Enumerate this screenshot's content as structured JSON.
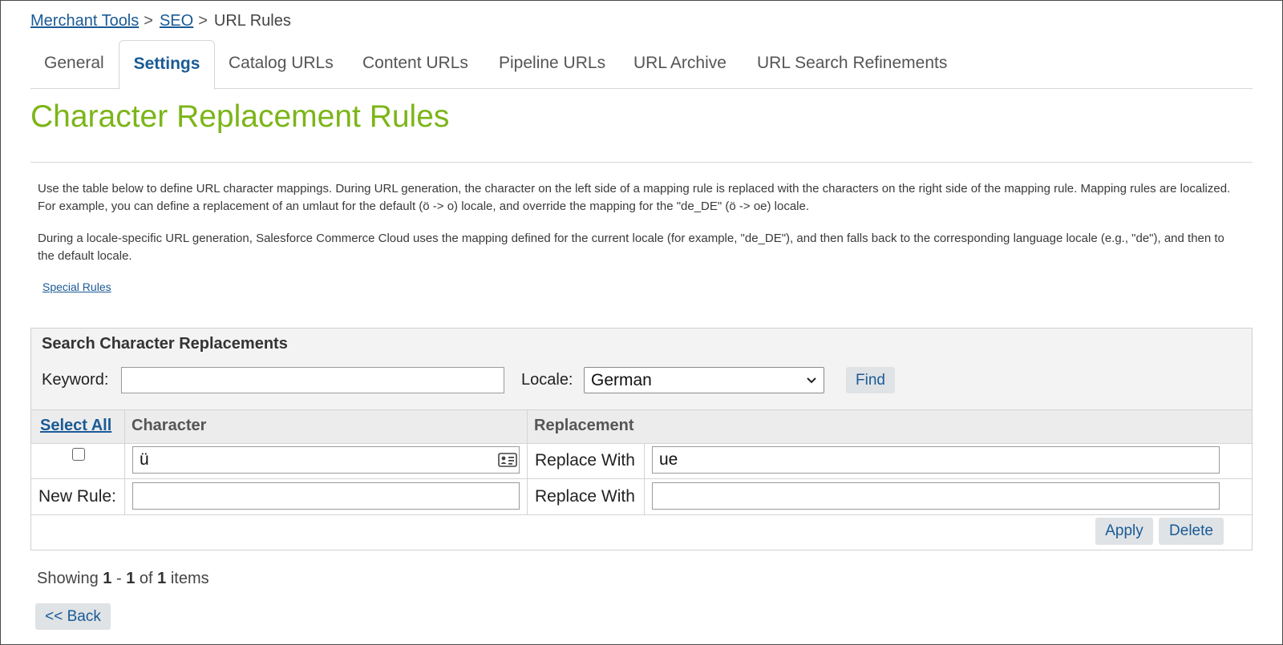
{
  "breadcrumb": {
    "items": [
      {
        "label": "Merchant Tools"
      },
      {
        "label": "SEO"
      }
    ],
    "separator": ">",
    "current": "URL Rules"
  },
  "tabs": [
    {
      "label": "General",
      "active": false
    },
    {
      "label": "Settings",
      "active": true
    },
    {
      "label": "Catalog URLs",
      "active": false
    },
    {
      "label": "Content URLs",
      "active": false
    },
    {
      "label": "Pipeline URLs",
      "active": false
    },
    {
      "label": "URL Archive",
      "active": false
    },
    {
      "label": "URL Search Refinements",
      "active": false
    }
  ],
  "page": {
    "title": "Character Replacement Rules",
    "description1": "Use the table below to define URL character mappings. During URL generation, the character on the left side of a mapping rule is replaced with the characters on the right side of the mapping rule. Mapping rules are localized. For example, you can define a replacement of an umlaut for the default (ö -> o) locale, and override the mapping for the \"de_DE\" (ö -> oe) locale.",
    "description2": "During a locale-specific URL generation, Salesforce Commerce Cloud uses the mapping defined for the current locale (for example, \"de_DE\"), and then falls back to the corresponding language locale (e.g., \"de\"), and then to the default locale.",
    "special_rules_link": "Special Rules"
  },
  "search": {
    "title": "Search Character Replacements",
    "keyword_label": "Keyword:",
    "keyword_value": "",
    "locale_label": "Locale:",
    "locale_value": "German",
    "find_button": "Find"
  },
  "table": {
    "select_all": "Select All",
    "col_character": "Character",
    "col_replacement": "Replacement",
    "rows": [
      {
        "checked": false,
        "character": "ü",
        "replace_label": "Replace With",
        "replacement": "ue"
      }
    ],
    "new_rule_label": "New Rule:",
    "new_rule_character": "",
    "new_rule_replace_label": "Replace With",
    "new_rule_replacement": ""
  },
  "actions": {
    "apply_button": "Apply",
    "delete_button": "Delete"
  },
  "pagination": {
    "showing_prefix": "Showing",
    "from": "1",
    "dash": "-",
    "to": "1",
    "of": "of",
    "total": "1",
    "suffix": "items"
  },
  "back_button": "<< Back",
  "colors": {
    "link": "#1a5a96",
    "title": "#7cb518",
    "button_bg": "#dfe3e6"
  }
}
